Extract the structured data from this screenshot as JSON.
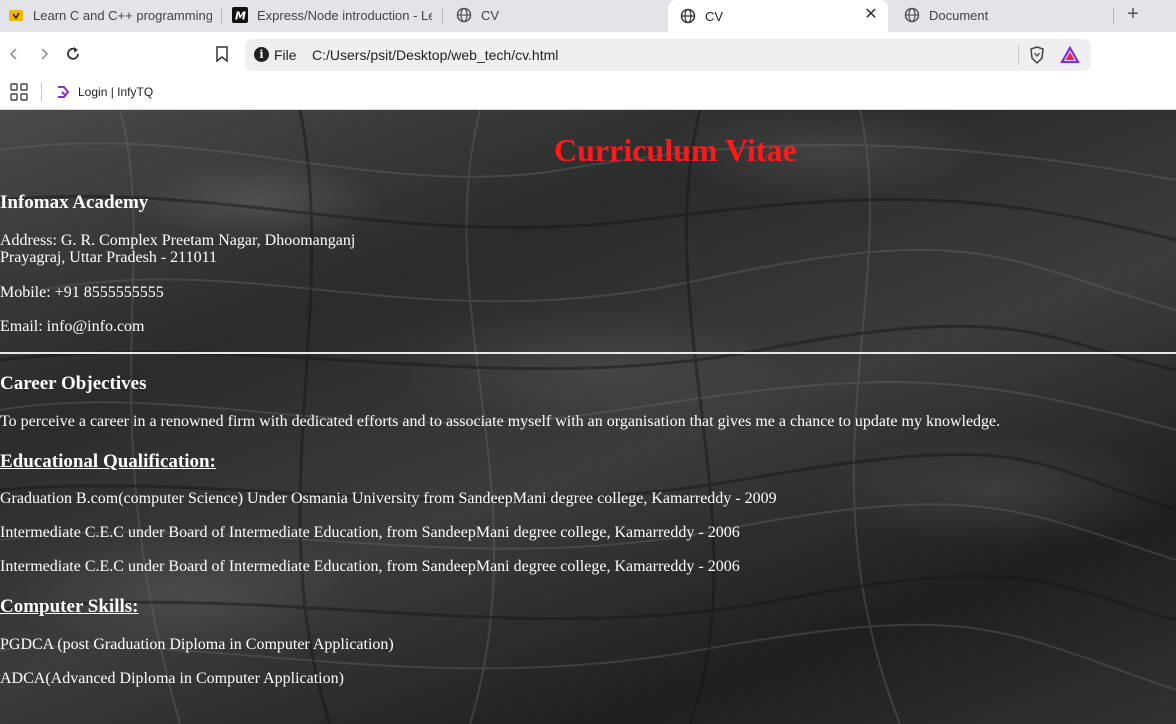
{
  "browser": {
    "tabs": [
      {
        "title": "Learn C and C++ programming la",
        "icon": "learn-c-icon"
      },
      {
        "title": "Express/Node introduction - Lear",
        "icon": "mdn-icon"
      },
      {
        "title": "CV",
        "icon": "globe-icon"
      },
      {
        "title": "CV",
        "icon": "globe-icon",
        "active": true
      },
      {
        "title": "Document",
        "icon": "globe-icon"
      }
    ],
    "address": {
      "scheme_label": "File",
      "url": "C:/Users/psit/Desktop/web_tech/cv.html"
    },
    "bookmarks": [
      {
        "label": "Login | InfyTQ",
        "icon": "infytq-icon"
      }
    ]
  },
  "cv": {
    "title": "Curriculum Vitae",
    "institution": "Infomax Academy",
    "address_line1": "Address: G. R. Complex Preetam Nagar, Dhoomanganj",
    "address_line2": "Prayagraj, Uttar Pradesh - 211011",
    "mobile": "Mobile: +91 8555555555",
    "email": "Email: info@info.com",
    "career_heading": "Career Objectives",
    "career_text": "To perceive a career in a renowned firm with dedicated efforts and to associate myself with an organisation that gives me a chance to update my knowledge.",
    "education_heading": "Educational Qualification:",
    "education": [
      "Graduation B.com(computer Science) Under Osmania University from SandeepMani degree college, Kamarreddy - 2009",
      "Intermediate C.E.C under Board of Intermediate Education, from SandeepMani degree college, Kamarreddy - 2006",
      "Intermediate C.E.C under Board of Intermediate Education, from SandeepMani degree college, Kamarreddy - 2006"
    ],
    "skills_heading": "Computer Skills:",
    "skills": [
      "PGDCA (post Graduation Diploma in Computer Application)",
      "ADCA(Advanced Diploma in Computer Application)"
    ]
  },
  "colors": {
    "title_red": "#ff1a1a",
    "tab_strip": "#e3e3e8",
    "omnibox": "#efeff2"
  }
}
